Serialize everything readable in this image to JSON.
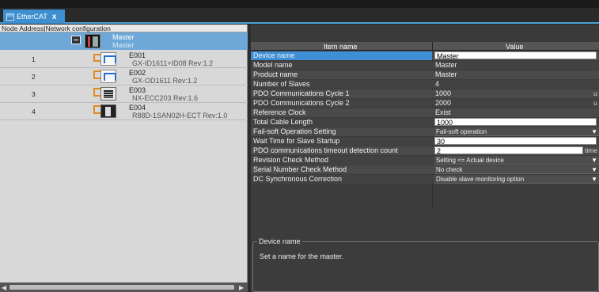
{
  "tab": {
    "label": "EtherCAT",
    "close": "x"
  },
  "left_panel": {
    "header": "Node Address|Network configuration",
    "master": {
      "name": "Master",
      "sub": "Master"
    },
    "nodes": [
      {
        "address": "1",
        "name": "E001",
        "model": "GX-ID1611+ID08 Rev:1.2"
      },
      {
        "address": "2",
        "name": "E002",
        "model": "GX-OD1611 Rev:1.2"
      },
      {
        "address": "3",
        "name": "E003",
        "model": "NX-ECC203 Rev:1.6"
      },
      {
        "address": "4",
        "name": "E004",
        "model": "R88D-1SAN02H-ECT Rev:1.0"
      }
    ]
  },
  "properties": {
    "col_item": "Item name",
    "col_value": "Value",
    "rows": [
      {
        "name": "Device name",
        "value": "Master",
        "kind": "input"
      },
      {
        "name": "Model name",
        "value": "Master",
        "kind": "text"
      },
      {
        "name": "Product name",
        "value": "Master",
        "kind": "text"
      },
      {
        "name": "Number of Slaves",
        "value": "4",
        "kind": "text"
      },
      {
        "name": "PDO Communications Cycle 1",
        "value": "1000",
        "kind": "text",
        "unit": "u"
      },
      {
        "name": "PDO Communications Cycle 2",
        "value": "2000",
        "kind": "text",
        "unit": "u"
      },
      {
        "name": "Reference Clock",
        "value": "Exist",
        "kind": "text"
      },
      {
        "name": "Total Cable Length",
        "value": "1000",
        "kind": "input"
      },
      {
        "name": "Fail-soft Operation Setting",
        "value": "Fail-soft operation",
        "kind": "select"
      },
      {
        "name": "Wait Time for Slave Startup",
        "value": "30",
        "kind": "input"
      },
      {
        "name": "PDO communications timeout detection count",
        "value": "2",
        "kind": "input",
        "unit": "time"
      },
      {
        "name": "Revision Check Method",
        "value": "Setting <= Actual device",
        "kind": "select"
      },
      {
        "name": "Serial Number Check Method",
        "value": "No check",
        "kind": "select"
      },
      {
        "name": "DC Synchronous Correction",
        "value": "Disable slave monitoring option",
        "kind": "select"
      }
    ]
  },
  "description": {
    "title": "Device name",
    "text": "Set a name for the master."
  },
  "colors": {
    "accent": "#3d8fcf",
    "selection": "#6ea8d8",
    "connector": "#e08b24"
  }
}
